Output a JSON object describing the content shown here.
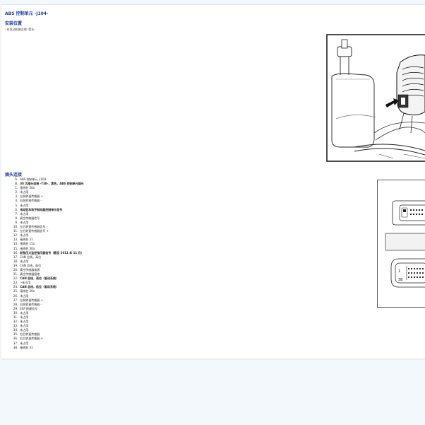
{
  "document": {
    "title": "ABS 控制单元 -J104-",
    "install": {
      "heading": "安装位置",
      "note": "- 在发动机舱左侧 -箭头-"
    },
    "connector": {
      "heading": "插头连接",
      "pins": [
        {
          "num": "A",
          "text": "ABS 控制单元 -J104-"
        },
        {
          "num": "B",
          "text": "38 芯插头连接 -T38-，黑色，ABS 控制单元插头",
          "bold": true
        },
        {
          "num": "1",
          "text": "接线柱 30a"
        },
        {
          "num": "2",
          "text": "未占用"
        },
        {
          "num": "3",
          "text": "左前转速传感器 +"
        },
        {
          "num": "4",
          "text": "右前转速传感器 -"
        },
        {
          "num": "5",
          "text": "未占用"
        },
        {
          "num": "6",
          "text": "电动驻车和手制动器控制单元信号",
          "bold": true
        },
        {
          "num": "7",
          "text": "未占用"
        },
        {
          "num": "8",
          "text": "真空传感器信号"
        },
        {
          "num": "9",
          "text": "未占用"
        },
        {
          "num": "10",
          "text": "左后转速传感器信号 -"
        },
        {
          "num": "11",
          "text": "左后转速传感器信号 +"
        },
        {
          "num": "12",
          "text": "未占用"
        },
        {
          "num": "13",
          "text": "接线柱 31"
        },
        {
          "num": "14",
          "text": "接线柱 15a"
        },
        {
          "num": "15",
          "text": "接线柱 30a"
        },
        {
          "num": "16",
          "text": "轮胎压力监控指示器信号（截至 2011 年 11 月）",
          "bold": true
        },
        {
          "num": "17",
          "text": "CAN 总线，高位"
        },
        {
          "num": "18",
          "text": "未占用"
        },
        {
          "num": "19",
          "text": "CAN 总线，低位"
        },
        {
          "num": "20",
          "text": "真空传感器电源"
        },
        {
          "num": "21",
          "text": "真空传感器接地"
        },
        {
          "num": "22",
          "text": "CAN 总线，高位（驱动系统）",
          "bold": true
        },
        {
          "num": "23",
          "text": "--未占用"
        },
        {
          "num": "24",
          "text": "CAN 总线，低位（驱动系统）",
          "bold": true
        },
        {
          "num": "25",
          "text": "接线柱 30a"
        },
        {
          "num": "26",
          "text": "未占用"
        },
        {
          "num": "27",
          "text": "左前转速传感器 +"
        },
        {
          "num": "28",
          "text": "右前转速传感器 -"
        },
        {
          "num": "29",
          "text": "ESP 按键信号"
        },
        {
          "num": "30",
          "text": "未占用"
        },
        {
          "num": "31",
          "text": "未占用"
        },
        {
          "num": "32",
          "text": "未占用"
        },
        {
          "num": "33",
          "text": "未占用"
        },
        {
          "num": "34",
          "text": "未占用"
        },
        {
          "num": "35",
          "text": "右后转速传感器"
        },
        {
          "num": "36",
          "text": "右后转速传感器 +"
        },
        {
          "num": "37",
          "text": "未占用"
        },
        {
          "num": "38",
          "text": "接线柱 31"
        }
      ]
    },
    "figure_connector": {
      "pin_label_top": "1",
      "pin_label_bottom": "38"
    }
  }
}
